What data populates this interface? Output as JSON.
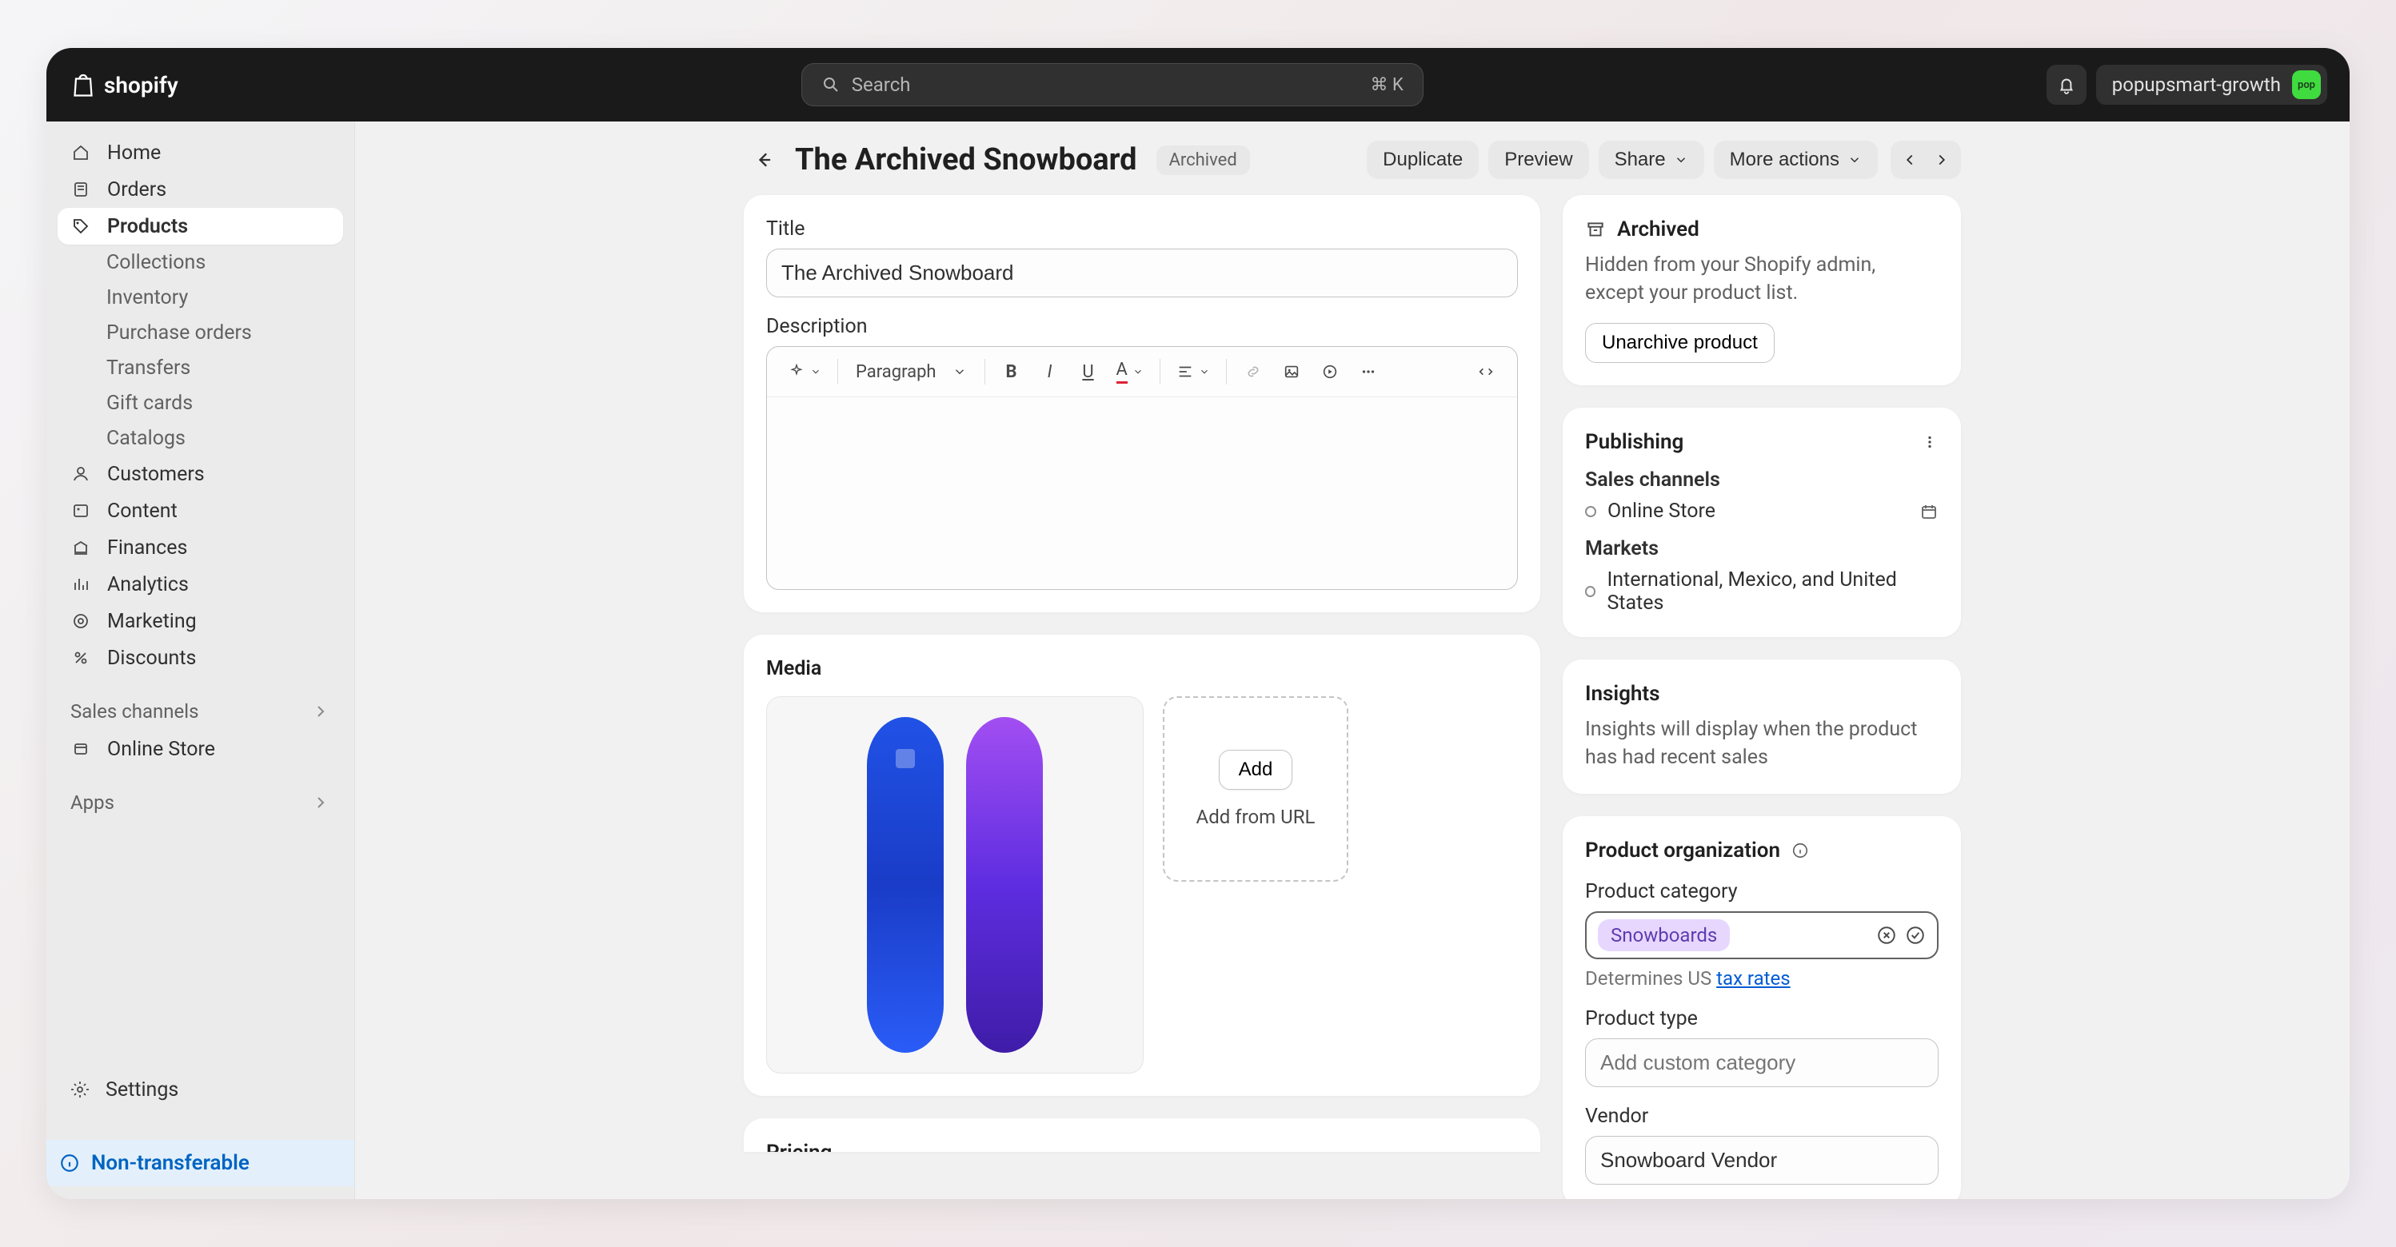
{
  "topbar": {
    "brand": "shopify",
    "search_placeholder": "Search",
    "shortcut": "⌘ K",
    "store_name": "popupsmart-growth",
    "avatar_text": "pop"
  },
  "sidebar": {
    "items": [
      {
        "label": "Home"
      },
      {
        "label": "Orders"
      },
      {
        "label": "Products",
        "active": true,
        "children": [
          {
            "label": "Collections"
          },
          {
            "label": "Inventory"
          },
          {
            "label": "Purchase orders"
          },
          {
            "label": "Transfers"
          },
          {
            "label": "Gift cards"
          },
          {
            "label": "Catalogs"
          }
        ]
      },
      {
        "label": "Customers"
      },
      {
        "label": "Content"
      },
      {
        "label": "Finances"
      },
      {
        "label": "Analytics"
      },
      {
        "label": "Marketing"
      },
      {
        "label": "Discounts"
      }
    ],
    "sales_channels_header": "Sales channels",
    "sales_channels": [
      {
        "label": "Online Store"
      }
    ],
    "apps_header": "Apps",
    "settings_label": "Settings",
    "plan_badge": "Non-transferable"
  },
  "page": {
    "title": "The Archived Snowboard",
    "status_badge": "Archived",
    "actions": {
      "duplicate": "Duplicate",
      "preview": "Preview",
      "share": "Share",
      "more": "More actions"
    },
    "title_field": {
      "label": "Title",
      "value": "The Archived Snowboard"
    },
    "description_field": {
      "label": "Description"
    },
    "rte": {
      "paragraph": "Paragraph"
    },
    "media": {
      "title": "Media",
      "add_button": "Add",
      "add_from_url": "Add from URL"
    },
    "pricing_title": "Pricing"
  },
  "right": {
    "archived": {
      "title": "Archived",
      "desc": "Hidden from your Shopify admin, except your product list.",
      "unarchive_btn": "Unarchive product"
    },
    "publishing": {
      "title": "Publishing",
      "sales_channels_label": "Sales channels",
      "online_store": "Online Store",
      "markets_label": "Markets",
      "markets_value": "International, Mexico, and United States"
    },
    "insights": {
      "title": "Insights",
      "desc": "Insights will display when the product has had recent sales"
    },
    "organization": {
      "title": "Product organization",
      "category_label": "Product category",
      "category_value": "Snowboards",
      "helper_prefix": "Determines US ",
      "helper_link": "tax rates",
      "type_label": "Product type",
      "type_placeholder": "Add custom category",
      "vendor_label": "Vendor",
      "vendor_value": "Snowboard Vendor"
    }
  }
}
